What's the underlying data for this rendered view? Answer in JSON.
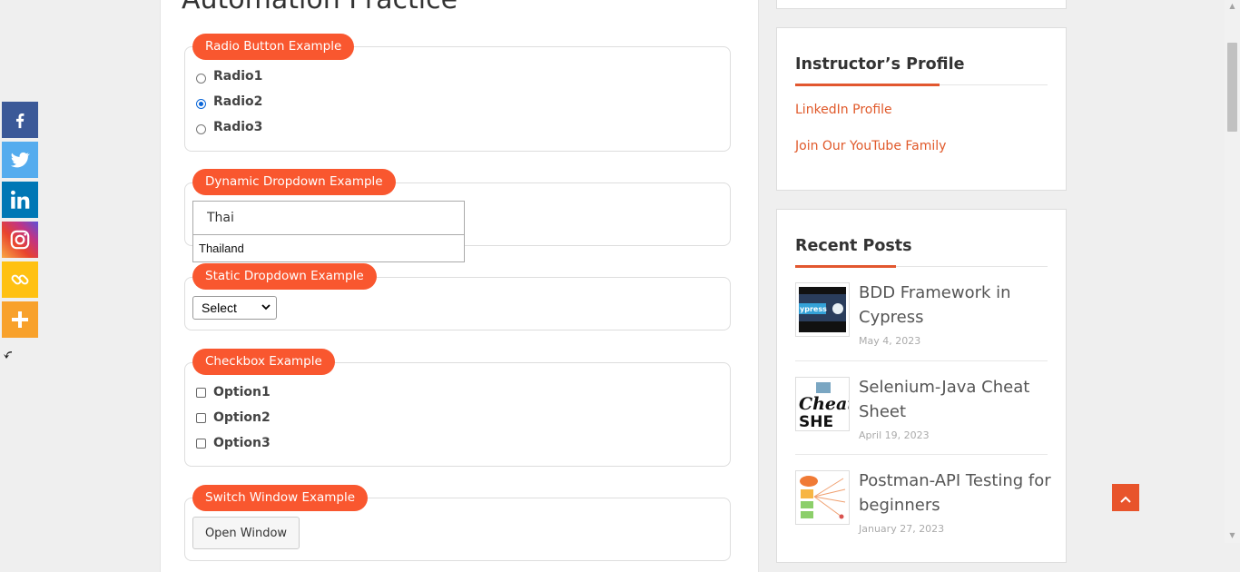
{
  "page": {
    "title": "Automation Practice"
  },
  "radio_section": {
    "legend": "Radio Button Example",
    "options": [
      {
        "label": "Radio1",
        "checked": false
      },
      {
        "label": "Radio2",
        "checked": true
      },
      {
        "label": "Radio3",
        "checked": false
      }
    ]
  },
  "dynamic_dropdown": {
    "legend": "Dynamic Dropdown Example",
    "input_value": "Thai",
    "suggestions": [
      "Thailand"
    ]
  },
  "static_dropdown": {
    "legend": "Static Dropdown Example",
    "selected": "Select"
  },
  "checkbox_section": {
    "legend": "Checkbox Example",
    "options": [
      {
        "label": "Option1",
        "checked": false
      },
      {
        "label": "Option2",
        "checked": false
      },
      {
        "label": "Option3",
        "checked": false
      }
    ]
  },
  "switch_window": {
    "legend": "Switch Window Example",
    "button_label": "Open Window"
  },
  "sidebar": {
    "instructor": {
      "title": "Instructor’s Profile",
      "links": [
        "LinkedIn Profile",
        "Join Our YouTube Family"
      ]
    },
    "recent_posts": {
      "title": "Recent Posts",
      "posts": [
        {
          "title": "BDD Framework in Cypress",
          "date": "May 4, 2023",
          "thumb_text": "ypress"
        },
        {
          "title": "Selenium-Java Cheat Sheet",
          "date": "April 19, 2023",
          "thumb_text": "Cheat SHE"
        },
        {
          "title": "Postman-API Testing for beginners",
          "date": "January 27, 2023",
          "thumb_text": ""
        }
      ]
    }
  },
  "share_bar": {
    "buttons": [
      {
        "name": "facebook",
        "color": "#3b5998"
      },
      {
        "name": "twitter",
        "color": "#55acee"
      },
      {
        "name": "linkedin",
        "color": "#0077b5"
      },
      {
        "name": "instagram",
        "color": "#c13584"
      },
      {
        "name": "copy-link",
        "color": "#ffc112"
      },
      {
        "name": "more",
        "color": "#f8a12b"
      }
    ]
  },
  "colors": {
    "accent": "#f9572f",
    "link": "#e0592a"
  }
}
